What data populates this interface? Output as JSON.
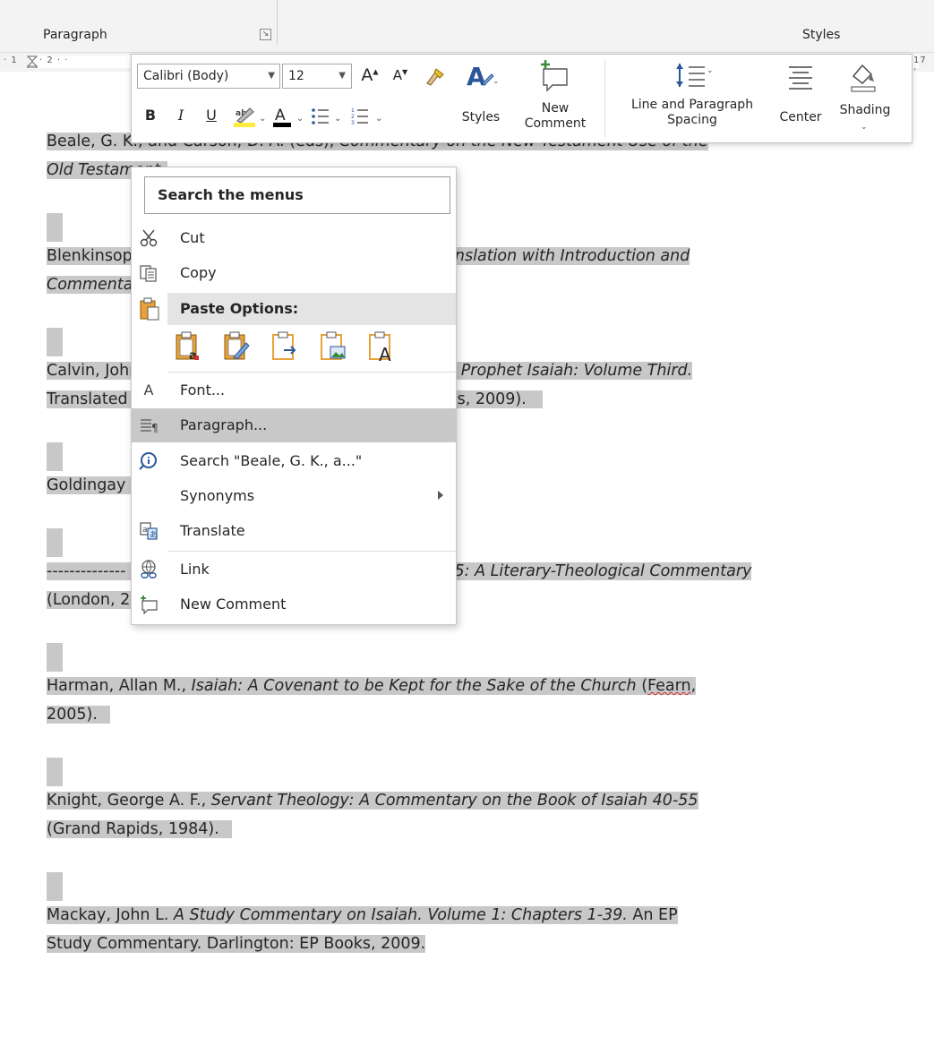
{
  "ribbon": {
    "paragraph_label": "Paragraph",
    "styles_label": "Styles",
    "launcher_glyph": "↘"
  },
  "ruler": {
    "left_text": "· 1",
    "left_text2": "· 2 · ·",
    "right_text": "17 ·"
  },
  "mini_toolbar": {
    "font_name": "Calibri (Body)",
    "font_size": "12",
    "grow_font": "A",
    "shrink_font": "A",
    "bold": "B",
    "italic": "I",
    "underline": "U",
    "font_color_glyph": "A",
    "styles_label": "Styles",
    "new_comment_label_line1": "New",
    "new_comment_label_line2": "Comment",
    "line_spacing_label_line1": "Line and Paragraph",
    "line_spacing_label_line2": "Spacing",
    "center_label": "Center",
    "shading_label": "Shading"
  },
  "context_menu": {
    "search_placeholder": "Search the menus",
    "items": [
      {
        "label": "Cut",
        "icon": "scissors-icon"
      },
      {
        "label": "Copy",
        "icon": "copy-icon"
      },
      {
        "label": "Font...",
        "icon": "font-icon"
      },
      {
        "label": "Paragraph...",
        "icon": "paragraph-icon"
      },
      {
        "label": "Search \"Beale, G. K., a...\"",
        "icon": "smart-lookup-icon"
      },
      {
        "label": "Synonyms",
        "icon": ""
      },
      {
        "label": "Translate",
        "icon": "translate-icon"
      },
      {
        "label": "Link",
        "icon": "link-icon"
      },
      {
        "label": "New Comment",
        "icon": "new-comment-icon"
      }
    ],
    "paste_options_label": "Paste Options:"
  },
  "document": {
    "entries": [
      {
        "plain": "Beale, G. K., and Carson, D. A. (eds), ",
        "italic": "Commentary on the New Testament Use of the",
        "line2_italic": "Old Testament",
        "line2_plain": ""
      },
      {
        "plain": "Blenkinsopp, ",
        "italic_right": "ranslation with Introduction and",
        "line2_italic": "Commentary",
        "line2_plain": ""
      },
      {
        "plain": "Calvin, John, ",
        "italic_right": "e Prophet Isaiah: Volume Third.",
        "line2_plain": "Translated",
        "line2_right": "s, 2009)."
      },
      {
        "plain": "Goldingay"
      },
      {
        "plain": "--------------",
        "italic_right": "55: A Literary-Theological Commentary",
        "line2_plain": "(London, 2005)."
      }
    ],
    "harman_plain": "Harman, Allan M., ",
    "harman_italic": "Isaiah: A Covenant to be Kept for the Sake of the Church",
    "harman_paren": " (",
    "harman_squiggle": "Fearn",
    "harman_end": ",",
    "harman_line2": "2005).",
    "knight_plain": "Knight, George A. F., ",
    "knight_italic": "Servant Theology: A Commentary on the Book of Isaiah 40-55",
    "knight_line2": "(Grand Rapids, 1984).",
    "mackay_plain": "Mackay, John L. ",
    "mackay_italic": "A Study Commentary on Isaiah. Volume 1: Chapters 1-39.",
    "mackay_plain2": " An EP",
    "mackay_line2": "Study Commentary. Darlington: EP Books, 2009."
  },
  "colors": {
    "selection": "#c8c8c8",
    "highlight_yellow": "#ffeb3b",
    "font_color_red": "#000000",
    "accent_blue": "#2b579a",
    "paste_orange": "#e8a23a"
  }
}
